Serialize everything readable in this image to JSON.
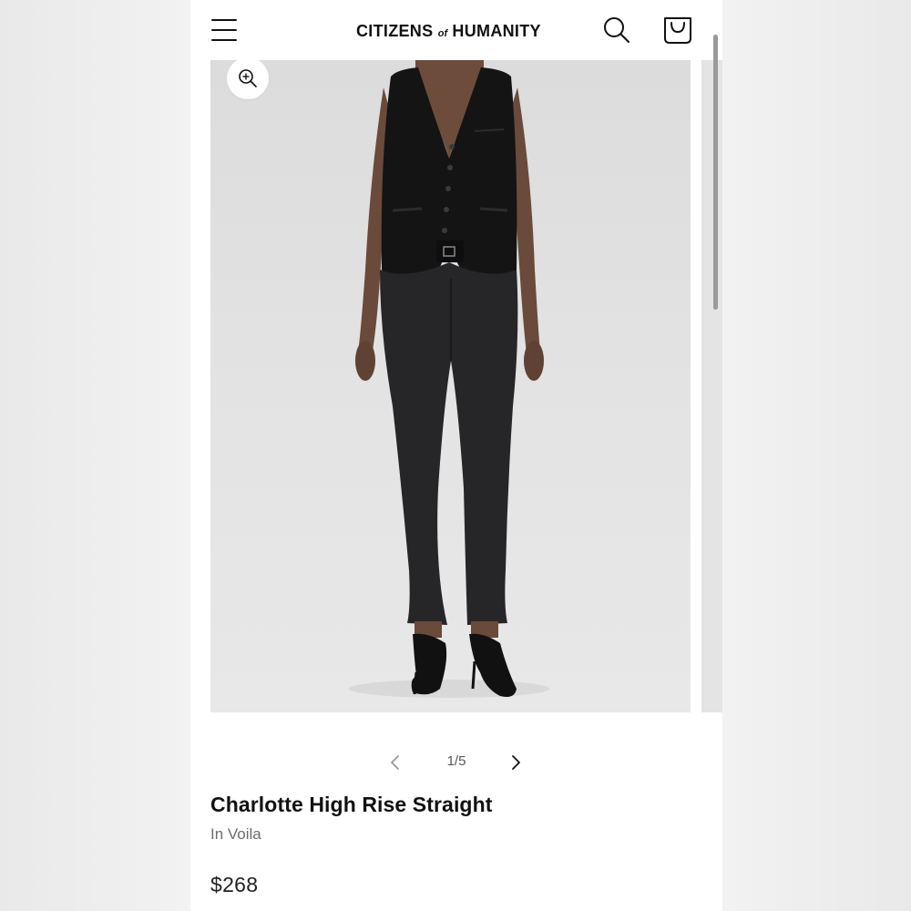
{
  "header": {
    "menu_icon": "hamburger-menu-icon",
    "brand_left": "CITIZENS",
    "brand_of": "of",
    "brand_right": "HUMANITY",
    "search_icon": "search-icon",
    "bag_icon": "shopping-bag-icon"
  },
  "gallery": {
    "zoom_icon": "zoom-in-icon",
    "current_index": 1,
    "total": 5,
    "counter_text": "1/5",
    "prev_icon": "chevron-left-icon",
    "next_icon": "chevron-right-icon",
    "photo": "model-wearing-black-vest-and-dark-straight-jeans"
  },
  "product": {
    "name": "Charlotte High Rise Straight",
    "color_label": "In Voila",
    "price": "$268"
  },
  "colors": {
    "text": "#111111",
    "muted": "#6b6b6b",
    "photo_bg": "#e0e0e0"
  }
}
